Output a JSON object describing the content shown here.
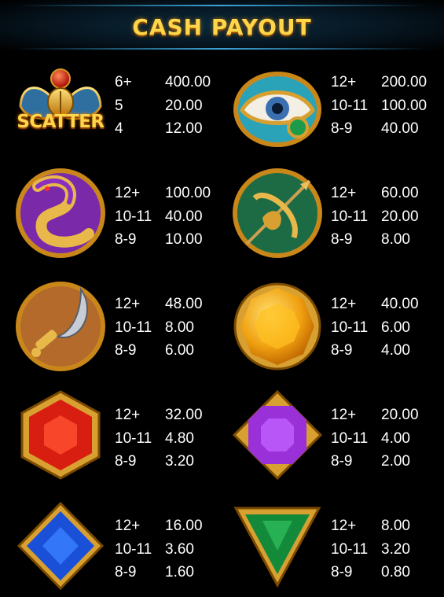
{
  "title": "CASH PAYOUT",
  "scatter_label": "SCATTER",
  "symbols": [
    {
      "icon": "scatter-scarab-icon",
      "rows": [
        {
          "count": "6+",
          "value": "400.00"
        },
        {
          "count": "5",
          "value": "20.00"
        },
        {
          "count": "4",
          "value": "12.00"
        }
      ]
    },
    {
      "icon": "eye-of-horus-icon",
      "rows": [
        {
          "count": "12+",
          "value": "200.00"
        },
        {
          "count": "10-11",
          "value": "100.00"
        },
        {
          "count": "8-9",
          "value": "40.00"
        }
      ]
    },
    {
      "icon": "cobra-icon",
      "rows": [
        {
          "count": "12+",
          "value": "100.00"
        },
        {
          "count": "10-11",
          "value": "40.00"
        },
        {
          "count": "8-9",
          "value": "10.00"
        }
      ]
    },
    {
      "icon": "bow-arrow-icon",
      "rows": [
        {
          "count": "12+",
          "value": "60.00"
        },
        {
          "count": "10-11",
          "value": "20.00"
        },
        {
          "count": "8-9",
          "value": "8.00"
        }
      ]
    },
    {
      "icon": "khopesh-sword-icon",
      "rows": [
        {
          "count": "12+",
          "value": "48.00"
        },
        {
          "count": "10-11",
          "value": "8.00"
        },
        {
          "count": "8-9",
          "value": "6.00"
        }
      ]
    },
    {
      "icon": "yellow-round-gem-icon",
      "rows": [
        {
          "count": "12+",
          "value": "40.00"
        },
        {
          "count": "10-11",
          "value": "6.00"
        },
        {
          "count": "8-9",
          "value": "4.00"
        }
      ]
    },
    {
      "icon": "red-hexagon-gem-icon",
      "rows": [
        {
          "count": "12+",
          "value": "32.00"
        },
        {
          "count": "10-11",
          "value": "4.80"
        },
        {
          "count": "8-9",
          "value": "3.20"
        }
      ]
    },
    {
      "icon": "purple-octagon-gem-icon",
      "rows": [
        {
          "count": "12+",
          "value": "20.00"
        },
        {
          "count": "10-11",
          "value": "4.00"
        },
        {
          "count": "8-9",
          "value": "2.00"
        }
      ]
    },
    {
      "icon": "blue-diamond-gem-icon",
      "rows": [
        {
          "count": "12+",
          "value": "16.00"
        },
        {
          "count": "10-11",
          "value": "3.60"
        },
        {
          "count": "8-9",
          "value": "1.60"
        }
      ]
    },
    {
      "icon": "green-triangle-gem-icon",
      "rows": [
        {
          "count": "12+",
          "value": "8.00"
        },
        {
          "count": "10-11",
          "value": "3.20"
        },
        {
          "count": "8-9",
          "value": "0.80"
        }
      ]
    }
  ]
}
